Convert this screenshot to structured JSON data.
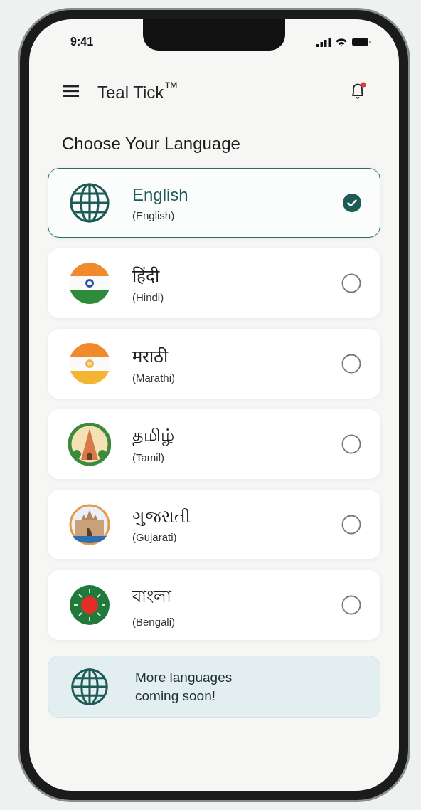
{
  "status_bar": {
    "time": "9:41"
  },
  "header": {
    "title": "Teal Tick$^{™}$",
    "unread_notifications": true
  },
  "heading": "Choose Your Language",
  "languages": [
    {
      "native": "English",
      "english": "(English)",
      "kind": "globe",
      "selected": true
    },
    {
      "native": "हिंदी",
      "english": "(Hindi)",
      "kind": "chakra-flag",
      "selected": false
    },
    {
      "native": "मराठी",
      "english": "(Marathi)",
      "kind": "saffron-flag",
      "selected": false
    },
    {
      "native": "தமிழ்",
      "english": "(Tamil)",
      "kind": "temple-emblem",
      "selected": false
    },
    {
      "native": "ગુજરાતી",
      "english": "(Gujarati)",
      "kind": "palace-emblem",
      "selected": false
    },
    {
      "native": "বাংলা",
      "english": "(Bengali)",
      "kind": "sun-emblem",
      "selected": false
    }
  ],
  "notice": {
    "text": "More languages coming soon!"
  }
}
